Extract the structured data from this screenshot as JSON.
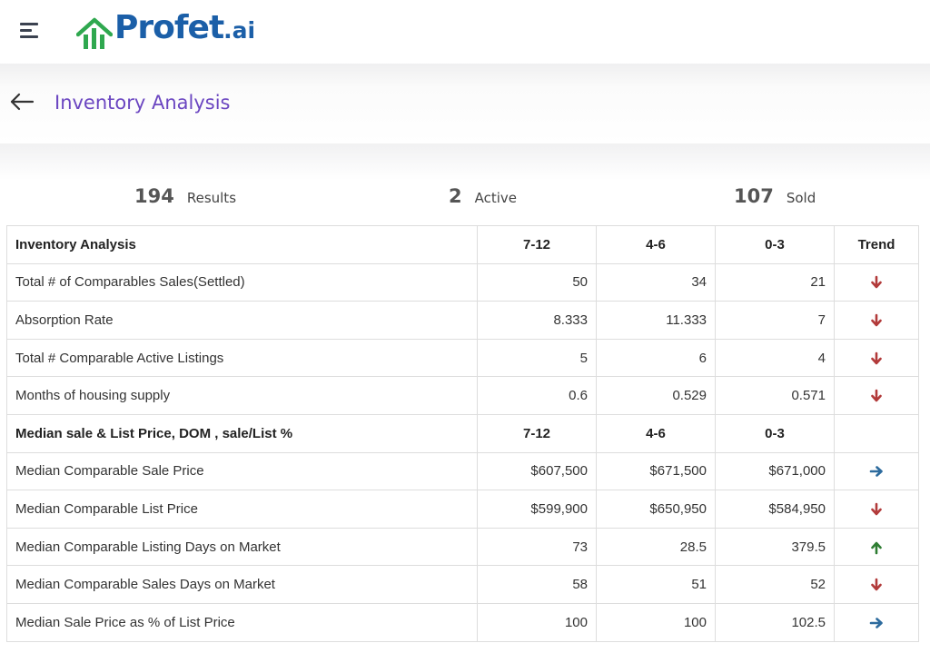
{
  "brand": {
    "name_main": "Profet",
    "name_suffix": ".ai",
    "colors": {
      "brand_blue": "#1b5fa8",
      "brand_green": "#2fa84f",
      "title_purple": "#6b46c1"
    }
  },
  "header": {
    "menu_icon": "hamburger-menu-icon"
  },
  "page": {
    "back_icon": "arrow-left-icon",
    "title": "Inventory Analysis"
  },
  "summary": {
    "results_count": "194",
    "results_label": "Results",
    "active_count": "2",
    "active_label": "Active",
    "sold_count": "107",
    "sold_label": "Sold"
  },
  "table": {
    "section1": {
      "header": {
        "label": "Inventory Analysis",
        "col1": "7-12",
        "col2": "4-6",
        "col3": "0-3",
        "trend": "Trend"
      },
      "rows": [
        {
          "label": "Total # of Comparables Sales(Settled)",
          "v1": "50",
          "v2": "34",
          "v3": "21",
          "trend": "down"
        },
        {
          "label": "Absorption Rate",
          "v1": "8.333",
          "v2": "11.333",
          "v3": "7",
          "trend": "down"
        },
        {
          "label": "Total # Comparable Active Listings",
          "v1": "5",
          "v2": "6",
          "v3": "4",
          "trend": "down"
        },
        {
          "label": "Months of housing supply",
          "v1": "0.6",
          "v2": "0.529",
          "v3": "0.571",
          "trend": "down"
        }
      ]
    },
    "section2": {
      "header": {
        "label": "Median sale & List Price, DOM , sale/List %",
        "col1": "7-12",
        "col2": "4-6",
        "col3": "0-3"
      },
      "rows": [
        {
          "label": "Median Comparable Sale Price",
          "v1": "$607,500",
          "v2": "$671,500",
          "v3": "$671,000",
          "trend": "right"
        },
        {
          "label": "Median Comparable List Price",
          "v1": "$599,900",
          "v2": "$650,950",
          "v3": "$584,950",
          "trend": "down"
        },
        {
          "label": "Median Comparable Listing Days on Market",
          "v1": "73",
          "v2": "28.5",
          "v3": "379.5",
          "trend": "up"
        },
        {
          "label": "Median Comparable Sales Days on Market",
          "v1": "58",
          "v2": "51",
          "v3": "52",
          "trend": "down"
        },
        {
          "label": "Median Sale Price as % of List Price",
          "v1": "100",
          "v2": "100",
          "v3": "102.5",
          "trend": "right"
        }
      ]
    },
    "trend_colors": {
      "down": "#b23a3a",
      "up": "#2e7d32",
      "right": "#2d6b9e"
    }
  }
}
